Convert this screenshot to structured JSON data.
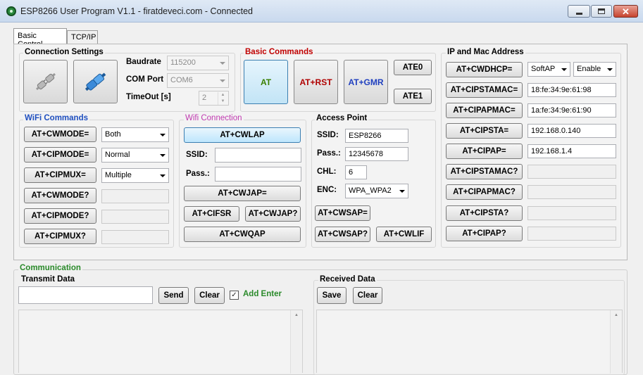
{
  "window": {
    "title": "ESP8266 User Program V1.1 - firatdeveci.com - Connected"
  },
  "tabs": [
    {
      "label": "Basic Control"
    },
    {
      "label": "TCP/IP"
    }
  ],
  "connection": {
    "title": "Connection Settings",
    "baudrate_label": "Baudrate",
    "baudrate_value": "115200",
    "com_label": "COM Port",
    "com_value": "COM6",
    "timeout_label": "TimeOut [s]",
    "timeout_value": "2"
  },
  "basic": {
    "title": "Basic Commands",
    "at": "AT",
    "rst": "AT+RST",
    "gmr": "AT+GMR",
    "ate0": "ATE0",
    "ate1": "ATE1",
    "colors": {
      "at": "#3a7f00",
      "rst": "#b00000",
      "gmr": "#1f3fbf",
      "title": "#c00000"
    }
  },
  "wifi_commands": {
    "title": "WiFi Commands",
    "cwmode_set": "AT+CWMODE=",
    "cwmode_value": "Both",
    "cipmode_set": "AT+CIPMODE=",
    "cipmode_value": "Normal",
    "cipmux_set": "AT+CIPMUX=",
    "cipmux_value": "Multiple",
    "cwmode_q": "AT+CWMODE?",
    "cipmode_q": "AT+CIPMODE?",
    "cipmux_q": "AT+CIPMUX?",
    "color": "#1f4fbf"
  },
  "wifi_connection": {
    "title": "Wifi Connection",
    "cwlap": "AT+CWLAP",
    "ssid_label": "SSID:",
    "pass_label": "Pass.:",
    "cwjap_set": "AT+CWJAP=",
    "cifsr": "AT+CIFSR",
    "cwjap_q": "AT+CWJAP?",
    "cwqap": "AT+CWQAP",
    "color": "#c03ab0"
  },
  "access_point": {
    "title": "Access Point",
    "ssid_label": "SSID:",
    "ssid_value": "ESP8266",
    "pass_label": "Pass.:",
    "pass_value": "12345678",
    "chl_label": "CHL:",
    "chl_value": "6",
    "enc_label": "ENC:",
    "enc_value": "WPA_WPA2",
    "cwsap_set": "AT+CWSAP=",
    "cwsap_q": "AT+CWSAP?",
    "cwlif": "AT+CWLIF"
  },
  "ip_mac": {
    "title": "IP and Mac Address",
    "cwdhcp": "AT+CWDHCP=",
    "dhcp_mode": "SoftAP",
    "dhcp_state": "Enable",
    "cipstamac_set": "AT+CIPSTAMAC=",
    "cipstamac_value": "18:fe:34:9e:61:98",
    "cipapmac_set": "AT+CIPAPMAC=",
    "cipapmac_value": "1a:fe:34:9e:61:90",
    "cipsta_set": "AT+CIPSTA=",
    "cipsta_value": "192.168.0.140",
    "cipap_set": "AT+CIPAP=",
    "cipap_value": "192.168.1.4",
    "cipstamac_q": "AT+CIPSTAMAC?",
    "cipapmac_q": "AT+CIPAPMAC?",
    "cipsta_q": "AT+CIPSTA?",
    "cipap_q": "AT+CIPAP?"
  },
  "communication": {
    "title": "Communication",
    "transmit_title": "Transmit Data",
    "send": "Send",
    "clear": "Clear",
    "add_enter": "Add Enter",
    "add_enter_checked": true,
    "received_title": "Received Data",
    "save": "Save",
    "clear_rx": "Clear",
    "color": "#2a8a2a"
  }
}
